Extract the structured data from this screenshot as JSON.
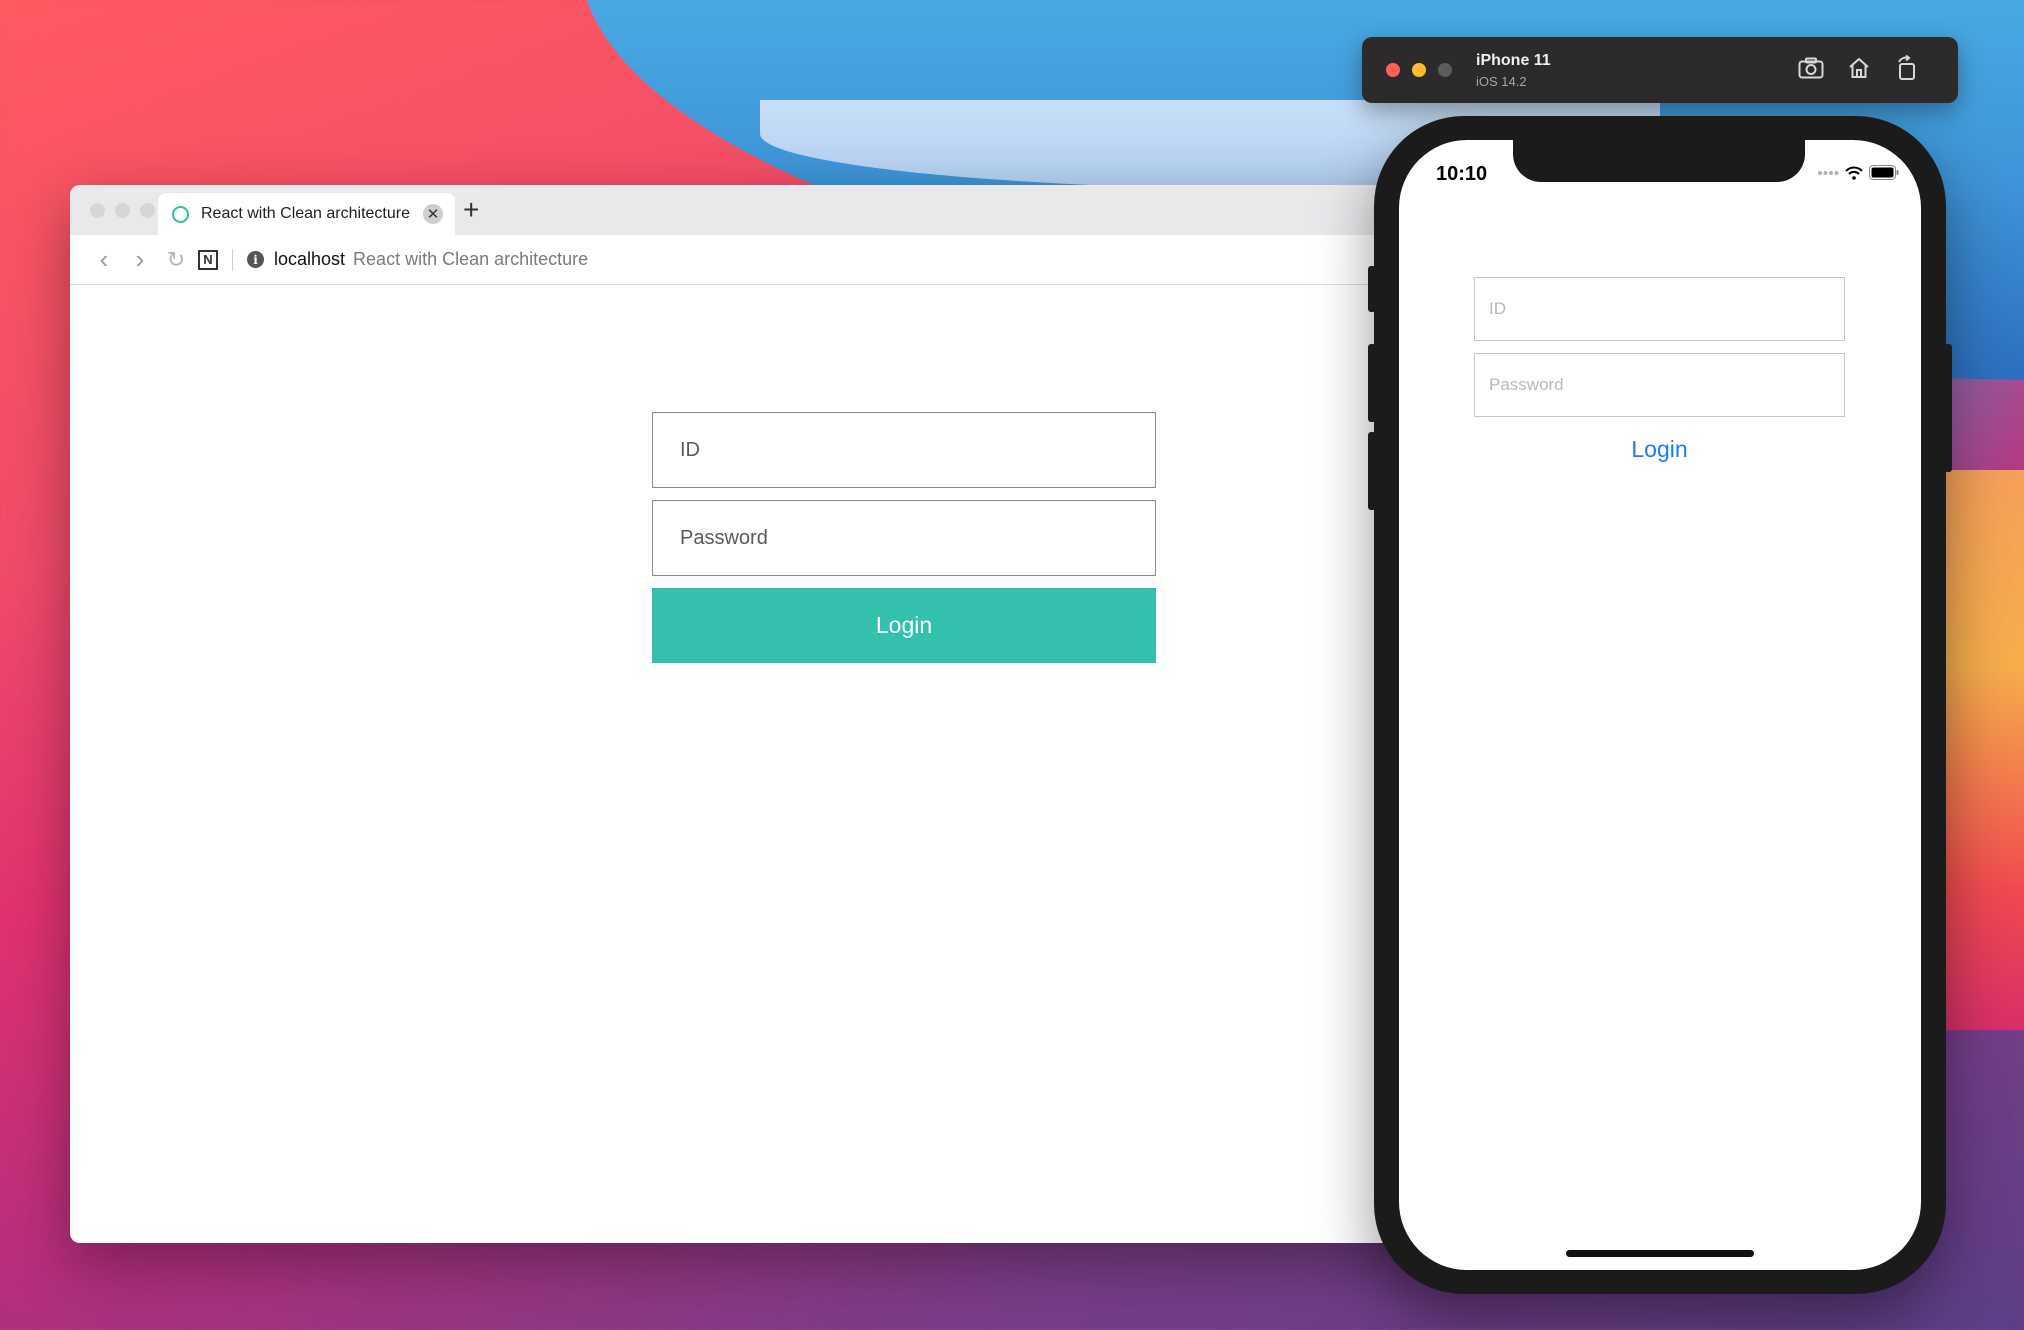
{
  "browser": {
    "tab_title": "React with Clean architecture",
    "tab_close_glyph": "✕",
    "new_tab_glyph": "+",
    "back_glyph": "‹",
    "forward_glyph": "›",
    "reload_glyph": "↻",
    "extension_letter": "N",
    "address_host": "localhost",
    "address_title": "React with Clean architecture",
    "info_glyph": "i",
    "form": {
      "id_placeholder": "ID",
      "password_placeholder": "Password",
      "login_label": "Login",
      "login_color": "#33c0ad"
    }
  },
  "simulator": {
    "device_name": "iPhone 11",
    "os_version": "iOS 14.2",
    "lights": [
      "#ff5f57",
      "#febc2e",
      "#5c5c5c"
    ],
    "tools": [
      "screenshot-icon",
      "home-icon",
      "rotate-icon"
    ]
  },
  "phone": {
    "status_time": "10:10",
    "form": {
      "id_placeholder": "ID",
      "password_placeholder": "Password",
      "login_label": "Login",
      "login_color": "#1a7cf0"
    }
  }
}
